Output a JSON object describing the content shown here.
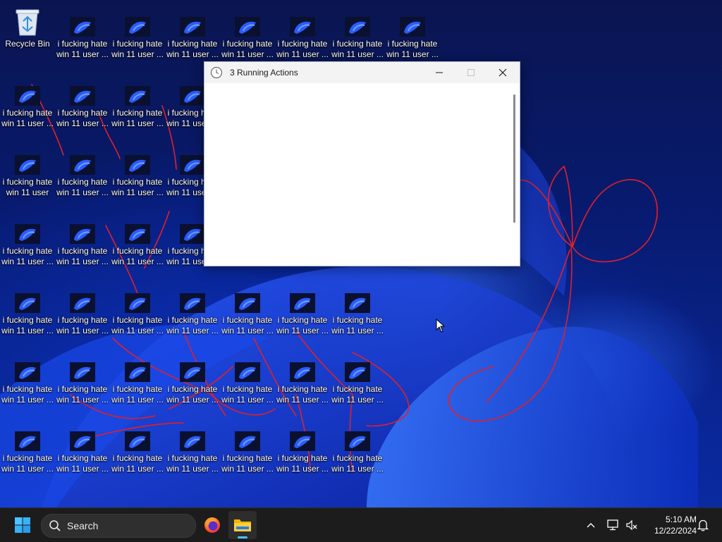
{
  "desktop": {
    "recycle_bin": {
      "label": "Recycle Bin",
      "icon": "recycle-bin-icon"
    },
    "shortcut_label_line1": "i fucking hate",
    "shortcut_label_line2": "win 11 user ...",
    "shortcut_label_line2_alt": "win 11 user",
    "shortcut_icon": "shortcut-thumbnail-icon"
  },
  "dialog": {
    "title": "3 Running Actions",
    "icon": "clock-icon",
    "minimize": "minimize-icon",
    "maximize": "maximize-icon",
    "close": "close-icon"
  },
  "taskbar": {
    "start_icon": "windows-logo-icon",
    "search_placeholder": "Search",
    "search_icon": "search-icon",
    "apps": [
      {
        "name": "Firefox",
        "icon": "firefox-icon"
      },
      {
        "name": "File Explorer",
        "icon": "folder-icon",
        "active": true
      }
    ],
    "tray": {
      "overflow_icon": "chevron-up-icon",
      "network_icon": "network-icon",
      "volume_icon": "volume-muted-icon",
      "time": "5:10 AM",
      "date": "12/22/2024",
      "notification_icon": "bell-icon"
    }
  },
  "colors": {
    "accent": "#0078d4",
    "annotation_red": "#e0202a",
    "taskbar": "#1c1c1c"
  }
}
